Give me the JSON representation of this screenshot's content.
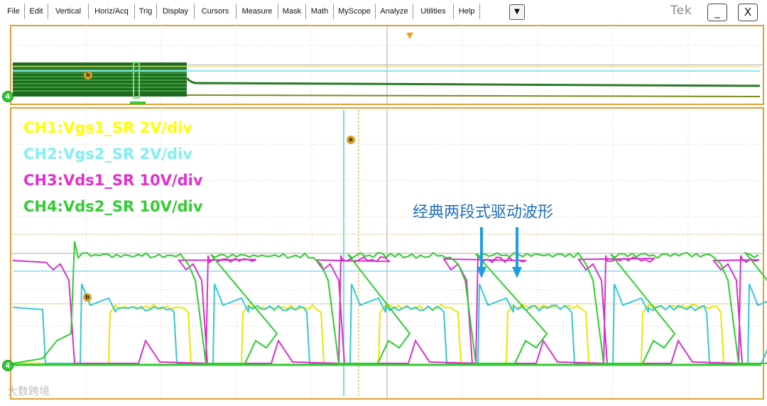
{
  "menu": {
    "items": [
      "File",
      "Edit",
      "Vertical",
      "Horiz/Acq",
      "Trig",
      "Display",
      "Cursors",
      "Measure",
      "Mask",
      "Math",
      "MyScope",
      "Analyze",
      "Utilities",
      "Help"
    ],
    "dropdown_glyph": "▼"
  },
  "window": {
    "brand": "Tek",
    "minimize_glyph": "_",
    "close_glyph": "X"
  },
  "channel_labels": [
    {
      "text": "CH1:Vgs1_SR 2V/div",
      "color": "#ffff00"
    },
    {
      "text": "CH2:Vgs2_SR 2V/div",
      "color": "#80f0f0"
    },
    {
      "text": "CH3:Vds1_SR 10V/div",
      "color": "#e030d0"
    },
    {
      "text": "CH4:Vds2_SR 10V/div",
      "color": "#33cc33"
    }
  ],
  "annotation": "经典两段式驱动波形",
  "watermark": "大数跨境",
  "ground_marker": "4",
  "cursor_a": "a",
  "cursor_b": "b",
  "colors": {
    "ch1": "#e8e800",
    "ch2": "#33c8d8",
    "ch3": "#d830c8",
    "ch4": "#2ecc2e",
    "grid_border": "#e0a030",
    "annotation": "#1f6fbf"
  },
  "icons": {
    "trigger_marker": "triangle-down-icon",
    "arrow": "arrow-down-icon"
  }
}
